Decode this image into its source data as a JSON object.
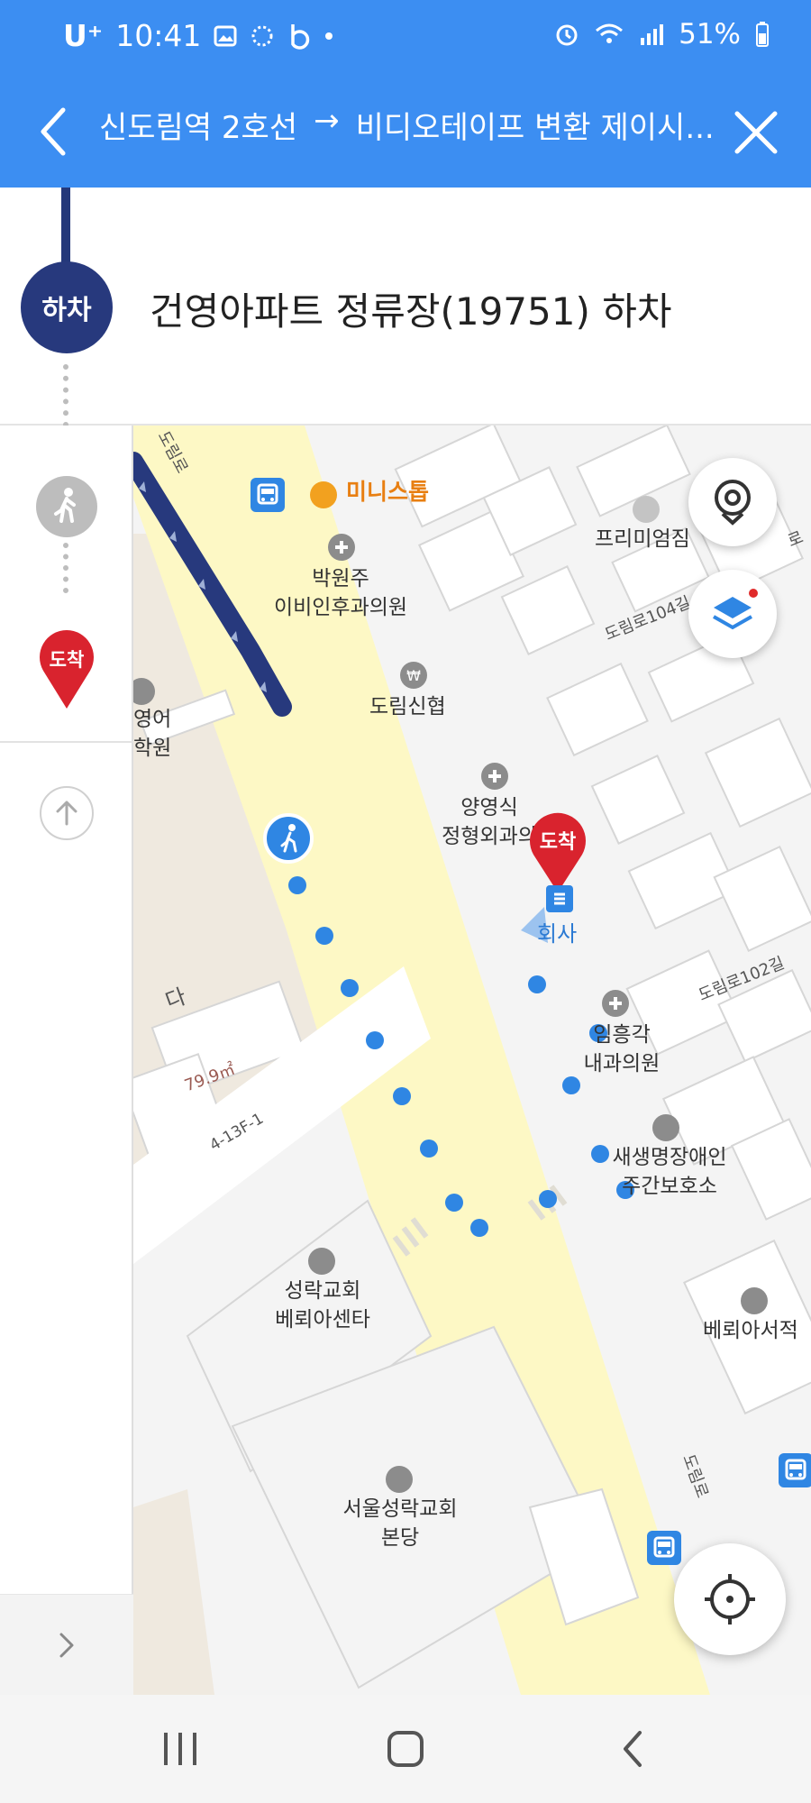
{
  "status_bar": {
    "carrier": "U⁺",
    "time": "10:41",
    "battery": "51%"
  },
  "header": {
    "origin": "신도림역 2호선",
    "arrow": "→",
    "destination": "비디오테이프 변환 제이시..."
  },
  "step": {
    "alight_badge": "하차",
    "stop_title": "건영아파트 정류장(19751) 하차"
  },
  "sidebar": {
    "arrive_badge": "도착"
  },
  "map": {
    "labels": {
      "ministop": "미니스톱",
      "clinic1_line1": "박원주",
      "clinic1_line2": "이비인후과의원",
      "bank": "도림신협",
      "premium_gym": "프리미엄짐",
      "english_academy_line1": "영어",
      "english_academy_line2": "학원",
      "clinic2_line1": "양영식",
      "clinic2_line2": "정형외과의",
      "company": "회사",
      "clinic3_line1": "임흥각",
      "clinic3_line2": "내과의원",
      "care_line1": "새생명장애인",
      "care_line2": "주간보호소",
      "church_center_line1": "성락교회",
      "church_center_line2": "베뢰아센타",
      "bookstore": "베뢰아서적",
      "church_main_line1": "서울성락교회",
      "church_main_line2": "본당",
      "area_da": "다",
      "area_size": "79.9㎡",
      "lot_code": "4-13F-1"
    },
    "streets": {
      "dorim_top": "도림로",
      "dorim_104": "도림로104길",
      "dorim_102": "도림로102길",
      "dorim_bottom": "도림로",
      "partial_ro": "로"
    },
    "destination_badge": "도착"
  },
  "colors": {
    "header_blue": "#3c8ef2",
    "route_navy": "#27397d",
    "walk_blue": "#2f86e3",
    "pin_red": "#d9232e",
    "road_yellow": "#fdf8c5"
  },
  "icons": {
    "back": "chevron-left-icon",
    "close": "close-icon",
    "walk": "walking-person-icon",
    "street_view": "street-view-icon",
    "layers": "layers-icon",
    "gps": "crosshair-icon",
    "bus": "bus-stop-icon"
  }
}
